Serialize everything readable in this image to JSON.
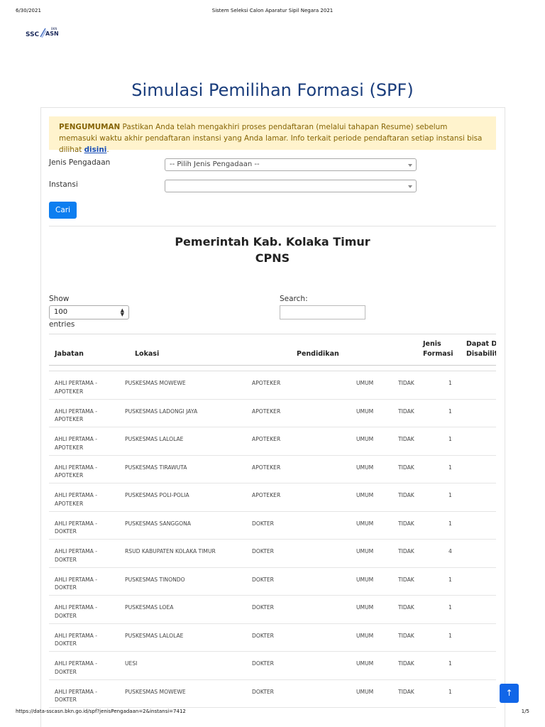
{
  "print": {
    "date": "6/30/2021",
    "title": "Sistem Seleksi Calon Aparatur Sipil Negara 2021",
    "url": "https://data-sscasn.bkn.go.id/spf?jenisPengadaan=2&instansi=7412",
    "pages": "1/5"
  },
  "logo": {
    "ssc": "SSC",
    "asn": "ASN",
    "bkn": "BKN"
  },
  "page_title": "Simulasi Pemilihan Formasi (SPF)",
  "announcement": {
    "label": "PENGUMUMAN",
    "text": " Pastikan Anda telah mengakhiri proses pendaftaran (melalui tahapan Resume) sebelum memasuki waktu akhir pendaftaran instansi yang Anda lamar. Info terkait periode pendaftaran setiap instansi bisa dilihat ",
    "link": "disini",
    "end": "."
  },
  "form": {
    "jenis_label": "Jenis Pengadaan",
    "jenis_value": "-- Pilih Jenis Pengadaan --",
    "instansi_label": "Instansi",
    "instansi_value": "",
    "search_button": "Cari"
  },
  "result": {
    "instansi": "Pemerintah Kab. Kolaka Timur",
    "jenis": "CPNS"
  },
  "table_controls": {
    "show_label": "Show",
    "entries_value": "100",
    "entries_label": "entries",
    "search_label": "Search:",
    "search_value": ""
  },
  "table": {
    "headers": {
      "jabatan": "Jabatan",
      "lokasi": "Lokasi",
      "pendidikan": "Pendidikan",
      "jenis_formasi_1": "Jenis",
      "jenis_formasi_2": "Formasi",
      "disabilitas_1": "Dapat Di",
      "disabilitas_2": "Disabilita"
    },
    "rows": [
      {
        "jabatan": "AHLI PERTAMA - APOTEKER",
        "lokasi": "PUSKESMAS MOWEWE",
        "pendidikan": "APOTEKER",
        "jenis": "UMUM",
        "disabilitas": "TIDAK",
        "jumlah": "1"
      },
      {
        "jabatan": "AHLI PERTAMA - APOTEKER",
        "lokasi": "PUSKESMAS LADONGI JAYA",
        "pendidikan": "APOTEKER",
        "jenis": "UMUM",
        "disabilitas": "TIDAK",
        "jumlah": "1"
      },
      {
        "jabatan": "AHLI PERTAMA - APOTEKER",
        "lokasi": "PUSKESMAS LALOLAE",
        "pendidikan": "APOTEKER",
        "jenis": "UMUM",
        "disabilitas": "TIDAK",
        "jumlah": "1"
      },
      {
        "jabatan": "AHLI PERTAMA - APOTEKER",
        "lokasi": "PUSKESMAS TIRAWUTA",
        "pendidikan": "APOTEKER",
        "jenis": "UMUM",
        "disabilitas": "TIDAK",
        "jumlah": "1"
      },
      {
        "jabatan": "AHLI PERTAMA - APOTEKER",
        "lokasi": "PUSKESMAS POLI-POLIA",
        "pendidikan": "APOTEKER",
        "jenis": "UMUM",
        "disabilitas": "TIDAK",
        "jumlah": "1"
      },
      {
        "jabatan": "AHLI PERTAMA - DOKTER",
        "lokasi": "PUSKESMAS SANGGONA",
        "pendidikan": "DOKTER",
        "jenis": "UMUM",
        "disabilitas": "TIDAK",
        "jumlah": "1"
      },
      {
        "jabatan": "AHLI PERTAMA - DOKTER",
        "lokasi": "RSUD KABUPATEN KOLAKA TIMUR",
        "pendidikan": "DOKTER",
        "jenis": "UMUM",
        "disabilitas": "TIDAK",
        "jumlah": "4"
      },
      {
        "jabatan": "AHLI PERTAMA - DOKTER",
        "lokasi": "PUSKESMAS TINONDO",
        "pendidikan": "DOKTER",
        "jenis": "UMUM",
        "disabilitas": "TIDAK",
        "jumlah": "1"
      },
      {
        "jabatan": "AHLI PERTAMA - DOKTER",
        "lokasi": "PUSKESMAS LOEA",
        "pendidikan": "DOKTER",
        "jenis": "UMUM",
        "disabilitas": "TIDAK",
        "jumlah": "1"
      },
      {
        "jabatan": "AHLI PERTAMA - DOKTER",
        "lokasi": "PUSKESMAS LALOLAE",
        "pendidikan": "DOKTER",
        "jenis": "UMUM",
        "disabilitas": "TIDAK",
        "jumlah": "1"
      },
      {
        "jabatan": "AHLI PERTAMA - DOKTER",
        "lokasi": "UESI",
        "pendidikan": "DOKTER",
        "jenis": "UMUM",
        "disabilitas": "TIDAK",
        "jumlah": "1"
      },
      {
        "jabatan": "AHLI PERTAMA - DOKTER",
        "lokasi": "PUSKESMAS MOWEWE",
        "pendidikan": "DOKTER",
        "jenis": "UMUM",
        "disabilitas": "TIDAK",
        "jumlah": "1"
      }
    ]
  },
  "scroll_top_icon": "arrow-up-icon",
  "colors": {
    "title": "#1a3d7c",
    "alert_bg": "#fff3cd",
    "alert_text": "#856404",
    "button": "#0d7ef0"
  }
}
